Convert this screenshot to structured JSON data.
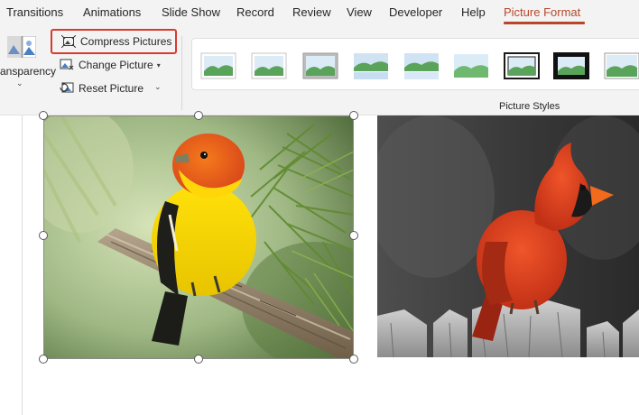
{
  "tabs": [
    {
      "label": "Transitions",
      "active": false
    },
    {
      "label": "Animations",
      "active": false
    },
    {
      "label": "Slide Show",
      "active": false
    },
    {
      "label": "Record",
      "active": false
    },
    {
      "label": "Review",
      "active": false
    },
    {
      "label": "View",
      "active": false
    },
    {
      "label": "Developer",
      "active": false
    },
    {
      "label": "Help",
      "active": false
    },
    {
      "label": "Picture Format",
      "active": true
    }
  ],
  "adjust": {
    "transparency_label": "ansparency",
    "compress_label": "Compress Pictures",
    "change_label": "Change Picture",
    "reset_label": "Reset Picture"
  },
  "picture_styles": {
    "group_label": "Picture Styles",
    "styles": [
      "simple-frame-white",
      "soft-edge-rectangle",
      "simple-frame-gray",
      "reflected-rounded",
      "reflected-soft",
      "soft-edge-oval",
      "simple-frame-black",
      "thick-matte-black",
      "beveled-matte-white"
    ]
  },
  "slide": {
    "images": [
      {
        "name": "western-tanager-photo",
        "selected": true
      },
      {
        "name": "northern-cardinal-photo",
        "selected": false
      }
    ]
  },
  "colors": {
    "accent": "#b7472a",
    "highlight_box": "#d83a2f"
  }
}
